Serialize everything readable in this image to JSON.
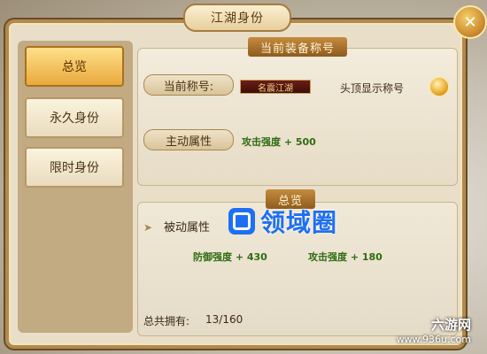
{
  "window": {
    "title": "江湖身份"
  },
  "close_icon": "close-icon",
  "sidebar": {
    "items": [
      {
        "label": "总览",
        "active": true
      },
      {
        "label": "永久身份",
        "active": false
      },
      {
        "label": "限时身份",
        "active": false
      }
    ]
  },
  "equipped": {
    "ribbon": "当前装备称号",
    "current_title_label": "当前称号:",
    "current_title_badge": "名震江湖",
    "show_title_label": "头顶显示称号",
    "active_attr_label": "主动属性",
    "active_attr_value": "攻击强度 + 500"
  },
  "overview": {
    "ribbon": "总览",
    "passive_label": "被动属性",
    "passive_values": [
      "防御强度 + 430",
      "攻击强度 + 180"
    ],
    "total_label": "总共拥有:",
    "total_value": "13/160"
  },
  "watermark": {
    "text": "领域圈"
  },
  "site": {
    "name": "六游网",
    "url": "www.936u.com"
  },
  "colors": {
    "accent": "#e9a93d",
    "attr_text": "#2f6c12",
    "watermark": "#1e6ff2"
  }
}
